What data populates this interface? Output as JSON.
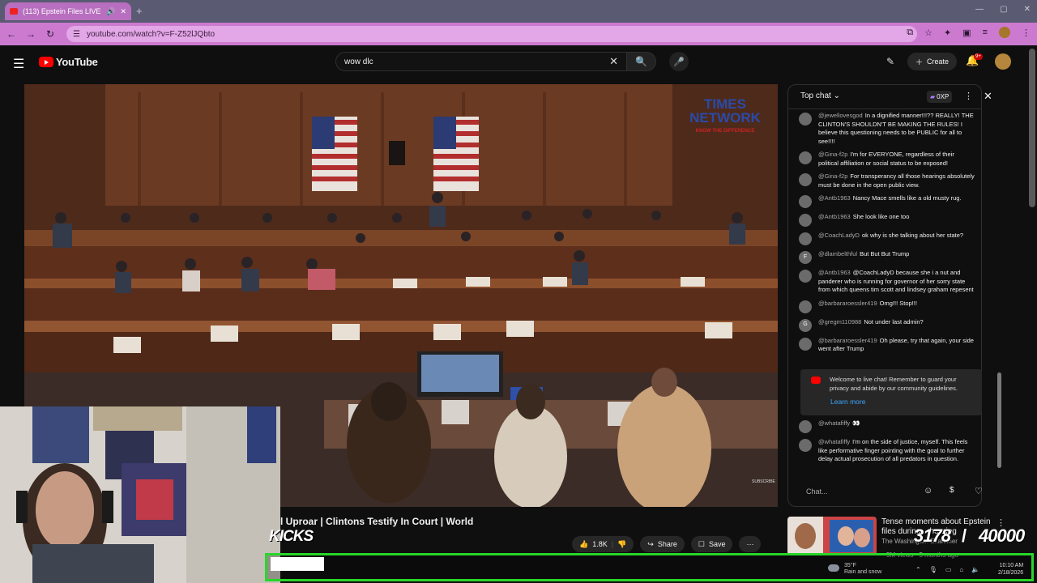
{
  "browser": {
    "tab_title": "(113) Epstein Files LIVE | Cli",
    "new_tab_symbol": "+",
    "url": "youtube.com/watch?v=F-Z52lJQbto"
  },
  "youtube": {
    "logo_text": "YouTube",
    "search_value": "wow dlc",
    "create_label": "Create",
    "notifications_badge": "9+"
  },
  "player": {
    "network_logo": "TIMES NETWORK",
    "network_tagline": "KNOW THE DIFFERENCE",
    "subscribe_watermark": "SUBSCRIBE"
  },
  "video": {
    "title_fragment": "l Uproar | Clintons Testify In Court | World",
    "like_count": "1.8K",
    "share_label": "Share",
    "save_label": "Save"
  },
  "overlay": {
    "kicks_label": "KICKS",
    "counter_current": "3178",
    "counter_goal": "40000",
    "bar_color": "#29d629"
  },
  "recommended": {
    "title": "Tense moments about Epstein files during... hearing",
    "channel": "The Washington Examiner",
    "meta": "5M views · 5 months ago"
  },
  "taskbar": {
    "weather_temp": "35°F",
    "weather_desc": "Rain and snow",
    "time": "10:10 AM",
    "date": "2/18/2026"
  },
  "chat": {
    "mode_label": "Top chat",
    "xp_label": "0XP",
    "input_placeholder": "Chat...",
    "welcome_text": "Welcome to live chat! Remember to guard your privacy and abide by our community guidelines.",
    "learn_more": "Learn more",
    "messages": [
      {
        "avatar": "",
        "author": "@jewellovesgod",
        "text": "In a dignified manner!!!?? REALLY! THE CLINTON'S SHOULDN'T BE MAKING THE RULES! I believe this questioning needs to be PUBLIC for all to see!!!!"
      },
      {
        "avatar": "",
        "author": "@Gina-f2p",
        "text": "I'm for EVERYONE, regardless of their political affiliation or social status to be exposed!"
      },
      {
        "avatar": "",
        "author": "@Gina-f2p",
        "text": "For transperancy all those hearings absolutely must be done in the open public view."
      },
      {
        "avatar": "",
        "author": "@Antb1963",
        "text": "Nancy Mace smells like a old musty rug."
      },
      {
        "avatar": "",
        "author": "@Antb1963",
        "text": "She look like one too"
      },
      {
        "avatar": "",
        "author": "@CoachLadyD",
        "text": "ok why is she talking about her state?"
      },
      {
        "avatar": "F",
        "author": "@dlambelthful",
        "text": "But But But Trump"
      },
      {
        "avatar": "",
        "author": "@Antb1963",
        "text": "@CoachLadyD because she i a nut and panderer who is running for governor of her sorry state from which queens tim scott and lindsey graham repesent"
      },
      {
        "avatar": "",
        "author": "@barbararoessler419",
        "text": "Omg!!! Stop!!!"
      },
      {
        "avatar": "G",
        "author": "@gregm110988",
        "text": "Not under last admin?"
      },
      {
        "avatar": "",
        "author": "@barbararoessler419",
        "text": "Oh please, try that again, your side went after Trump"
      }
    ],
    "messages_after": [
      {
        "avatar": "",
        "author": "@whatafiffy",
        "text": "👀"
      },
      {
        "avatar": "",
        "author": "@whatafiffy",
        "text": "I'm on the side of justice, myself. This feels like performative finger pointing with the goal to further delay actual prosecution of all predators in question."
      }
    ]
  }
}
